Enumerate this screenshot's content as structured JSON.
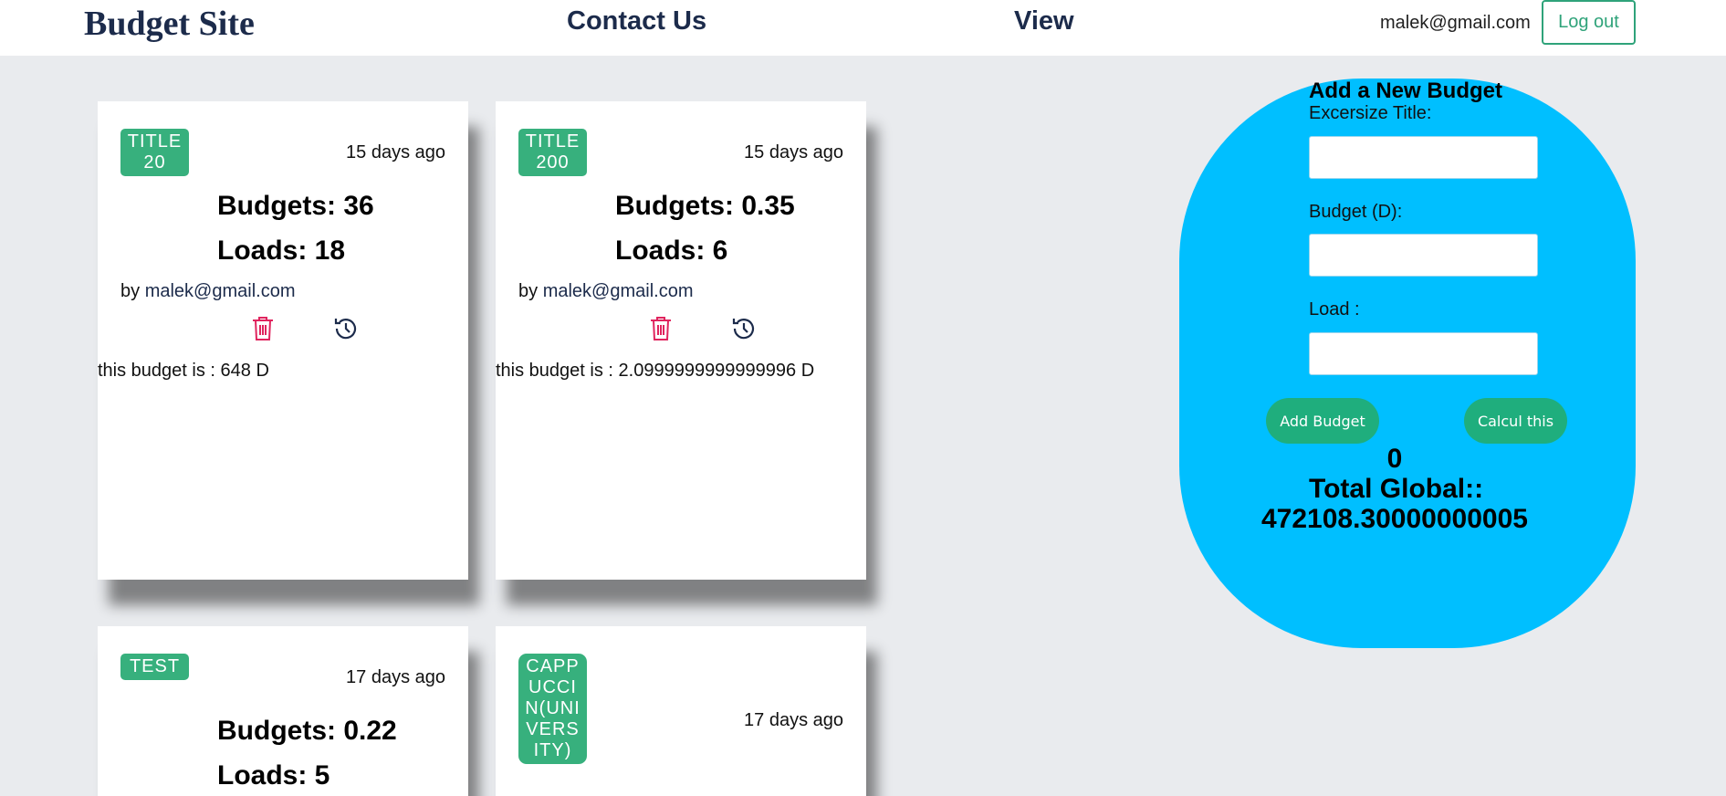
{
  "nav": {
    "brand": "Budget Site",
    "contact": "Contact Us",
    "view": "View",
    "user_email": "malek@gmail.com",
    "logout": "Log out"
  },
  "cards": [
    {
      "tag": "TITLE 20",
      "date": "15 days ago",
      "budgets": "Budgets: 36",
      "loads": "Loads: 18",
      "by": "by",
      "author": "malek@gmail.com",
      "total": "this budget is : 648 D"
    },
    {
      "tag": "TITLE200",
      "date": "15 days ago",
      "budgets": "Budgets: 0.35",
      "loads": "Loads: 6",
      "by": "by",
      "author": "malek@gmail.com",
      "total": "this budget is : 2.0999999999999996 D"
    },
    {
      "tag": "TEST",
      "date": "17 days ago",
      "budgets": "Budgets: 0.22",
      "loads": "Loads: 5"
    },
    {
      "tag": "CAPPUCCIN(UNIVERSITY)",
      "date": "17 days ago"
    }
  ],
  "form": {
    "title": "Add a New Budget",
    "title_label": "Excersize Title:",
    "budget_label": "Budget (D):",
    "load_label": "Load :",
    "title_value": "",
    "budget_value": "",
    "load_value": "",
    "add_button": "Add Budget",
    "calc_button": "Calcul this",
    "result": "0",
    "global_label": "Total Global::",
    "global_value": "472108.30000000005"
  },
  "colors": {
    "tag": "#37b07d",
    "delete_icon": "#e0245e",
    "panel": "#00bfff",
    "button": "#1fae7d",
    "brand_text": "#1c2b4b"
  },
  "icons": {
    "delete": "trash-icon",
    "history": "history-icon"
  }
}
